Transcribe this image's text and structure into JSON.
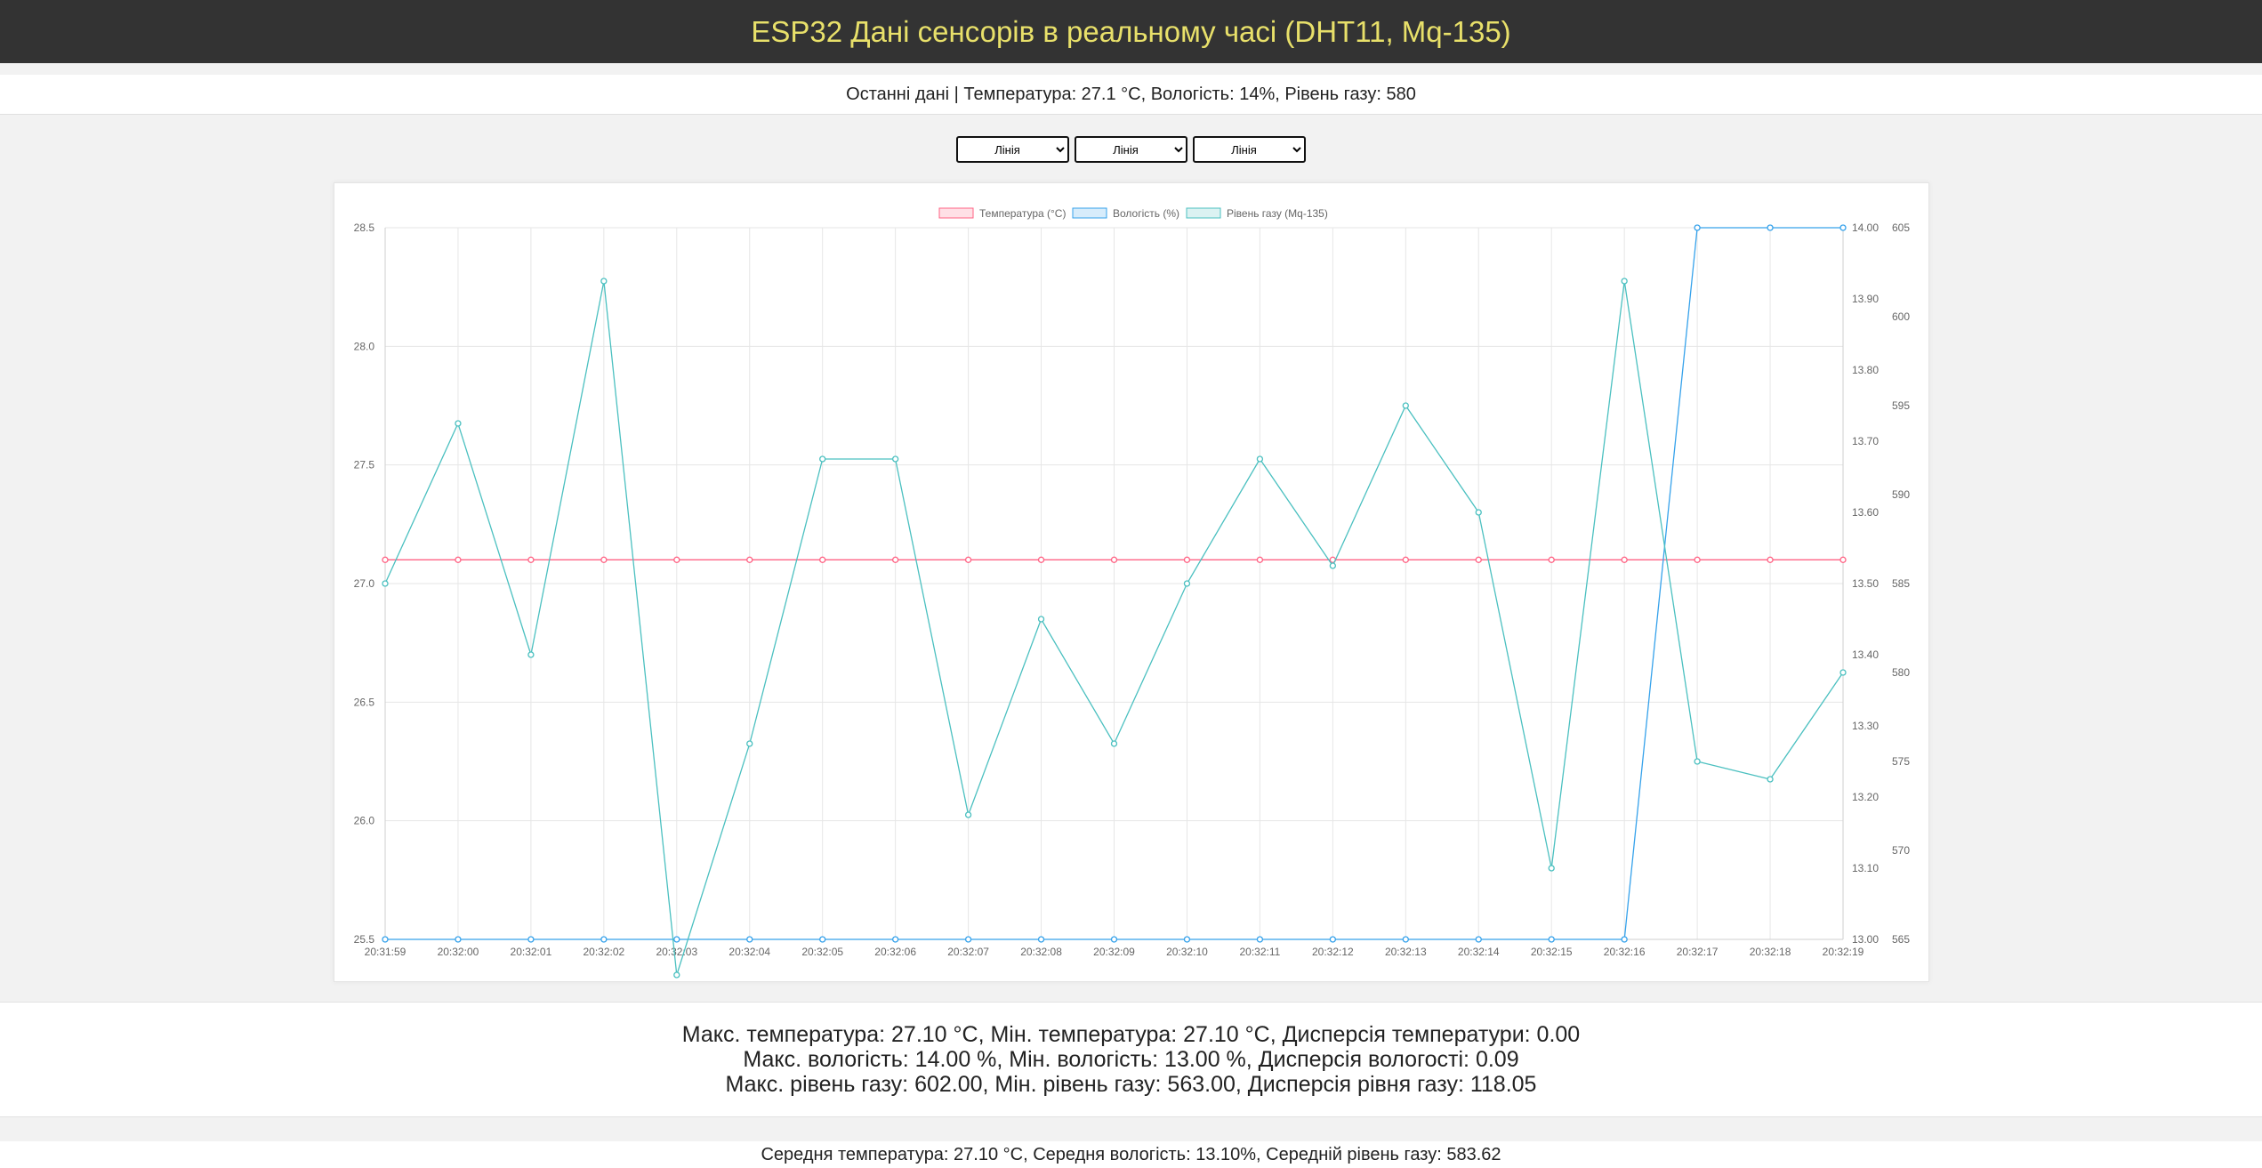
{
  "header": {
    "title": "ESP32 Дані сенсорів в реальному часі (DHT11, Mq-135)"
  },
  "latest": {
    "text": "Останні дані | Температура: 27.1 °C, Вологість: 14%, Рівень газу: 580"
  },
  "selectors": [
    {
      "selected": "Лінія"
    },
    {
      "selected": "Лінія"
    },
    {
      "selected": "Лінія"
    }
  ],
  "chart_data": {
    "type": "line",
    "x": [
      "20:31:59",
      "20:32:00",
      "20:32:01",
      "20:32:02",
      "20:32:03",
      "20:32:04",
      "20:32:05",
      "20:32:06",
      "20:32:07",
      "20:32:08",
      "20:32:09",
      "20:32:10",
      "20:32:11",
      "20:32:12",
      "20:32:13",
      "20:32:14",
      "20:32:15",
      "20:32:16",
      "20:32:17",
      "20:32:18",
      "20:32:19"
    ],
    "series": [
      {
        "name": "Температура (°C)",
        "axis": "y",
        "color": "#ff6384",
        "values": [
          27.1,
          27.1,
          27.1,
          27.1,
          27.1,
          27.1,
          27.1,
          27.1,
          27.1,
          27.1,
          27.1,
          27.1,
          27.1,
          27.1,
          27.1,
          27.1,
          27.1,
          27.1,
          27.1,
          27.1,
          27.1
        ]
      },
      {
        "name": "Вологість (%)",
        "axis": "y1",
        "color": "#36a2eb",
        "values": [
          13,
          13,
          13,
          13,
          13,
          13,
          13,
          13,
          13,
          13,
          13,
          13,
          13,
          13,
          13,
          13,
          13,
          13,
          14,
          14,
          14
        ]
      },
      {
        "name": "Рівень газу (Mq-135)",
        "axis": "y2",
        "color": "#4bc0c0",
        "values": [
          585,
          594,
          581,
          602,
          563,
          576,
          592,
          592,
          572,
          583,
          576,
          585,
          592,
          586,
          595,
          589,
          569,
          602,
          575,
          574,
          580
        ]
      }
    ],
    "axes": {
      "y": {
        "position": "left",
        "min": 25.5,
        "max": 28.5,
        "ticks": [
          "28.5",
          "28.0",
          "27.5",
          "27.0",
          "26.5",
          "26.0",
          "25.5"
        ]
      },
      "y1": {
        "position": "right",
        "min": 13.0,
        "max": 14.0,
        "ticks": [
          "14.00",
          "13.90",
          "13.80",
          "13.70",
          "13.60",
          "13.50",
          "13.40",
          "13.30",
          "13.20",
          "13.10",
          "13.00"
        ]
      },
      "y2": {
        "position": "right",
        "min": 565,
        "max": 605,
        "ticks": [
          "605",
          "600",
          "595",
          "590",
          "585",
          "580",
          "575",
          "570",
          "565"
        ]
      }
    },
    "grid": true,
    "legend": "top"
  },
  "stats": {
    "line1": "Макс. температура: 27.10 °C, Мін. температура: 27.10 °C, Дисперсія температури: 0.00",
    "line2": "Макс. вологість: 14.00 %, Мін. вологість: 13.00 %, Дисперсія вологості: 0.09",
    "line3": "Макс. рівень газу: 602.00, Мін. рівень газу: 563.00, Дисперсія рівня газу: 118.05"
  },
  "averages": {
    "text": "Середня температура: 27.10 °C, Середня вологість: 13.10%, Середній рівень газу: 583.62"
  }
}
